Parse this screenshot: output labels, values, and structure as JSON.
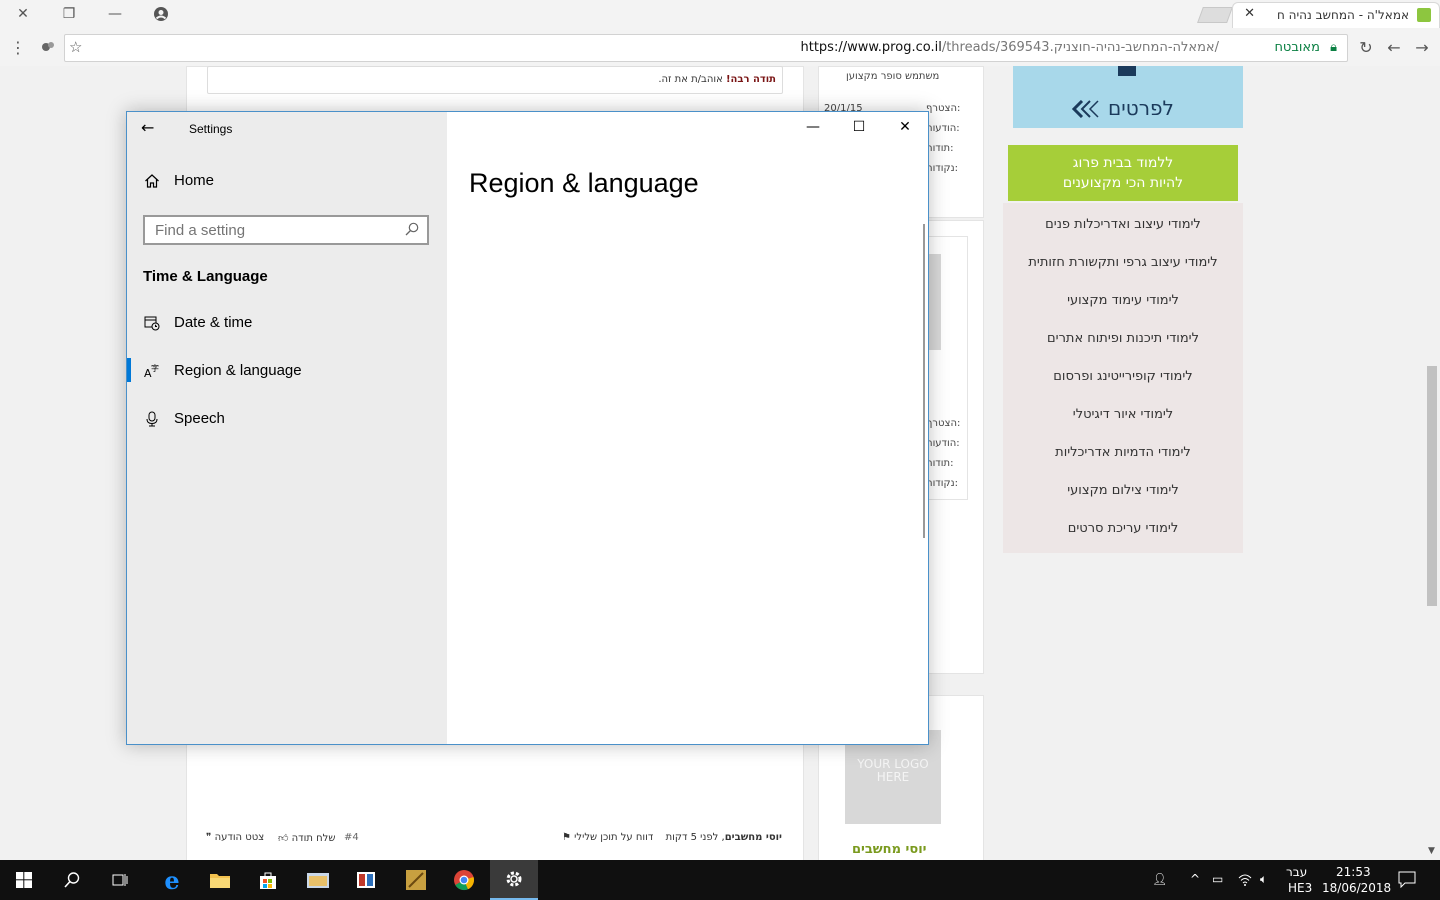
{
  "browser": {
    "tab_title": "אמאל'ה - המחשב נהיה ח",
    "url_host": "https://www.prog.co.il",
    "url_path": "/threads/369543.אמאלה-המחשב-נהיה-חוצניק/",
    "secure_label": "מאובטח"
  },
  "page": {
    "thanks_bold": "תודה רבה!",
    "thanks_rest": " אוהב/ת את זה.",
    "side_user_title": "משתמש סופר מקצוען",
    "side_date": "20/1/15",
    "side_labels_1": [
      "הצטרף:",
      "הודעות:",
      "תודות:",
      "נקודות:"
    ],
    "side_labels_2": [
      "הצטרף:",
      "הודעות:",
      "תודות:",
      "נקודות:"
    ],
    "ad_label": "לפרטים",
    "green_line1": "ללמוד בבית פרוג",
    "green_line2": "להיות הכי מקצוענים",
    "courses": [
      "לימודי עיצוב ואדריכלות פנים",
      "לימודי עיצוב גרפי ותקשורת חזותית",
      "לימודי עימוד מקצועי",
      "לימודי תיכנות ופיתוח אתרים",
      "לימודי קופירייטינג ופרסום",
      "לימודי איור דיגיטלי",
      "לימודי הדמיות אדריכליות",
      "לימודי צילום מקצועי",
      "לימודי עריכת סרטים"
    ],
    "logo_placeholder": "YOUR LOGO HERE",
    "author_name": "יוסי מחשבים",
    "post_author": "יוסי מחשבים",
    "post_time": ", לפני 5 דקות",
    "report_label": "דווח על תוכן שלילי",
    "post_number": "#4",
    "thank_label": "שלח תודה",
    "quote_label": "צטט הודעה"
  },
  "settings": {
    "window_title": "Settings",
    "home_label": "Home",
    "search_placeholder": "Find a setting",
    "section_title": "Time & Language",
    "nav_items": [
      {
        "label": "Date & time",
        "icon": "calendar-clock-icon"
      },
      {
        "label": "Region & language",
        "icon": "language-icon"
      },
      {
        "label": "Speech",
        "icon": "microphone-icon"
      }
    ],
    "selected_item": "Region & language",
    "content_title": "Region & language"
  },
  "taskbar": {
    "lang": "עבר",
    "lang_code": "HE3",
    "time": "21:53",
    "date": "18/06/2018"
  },
  "colors": {
    "accent": "#0078d7",
    "green_banner": "#a6ce39",
    "taskbar": "#101010"
  }
}
